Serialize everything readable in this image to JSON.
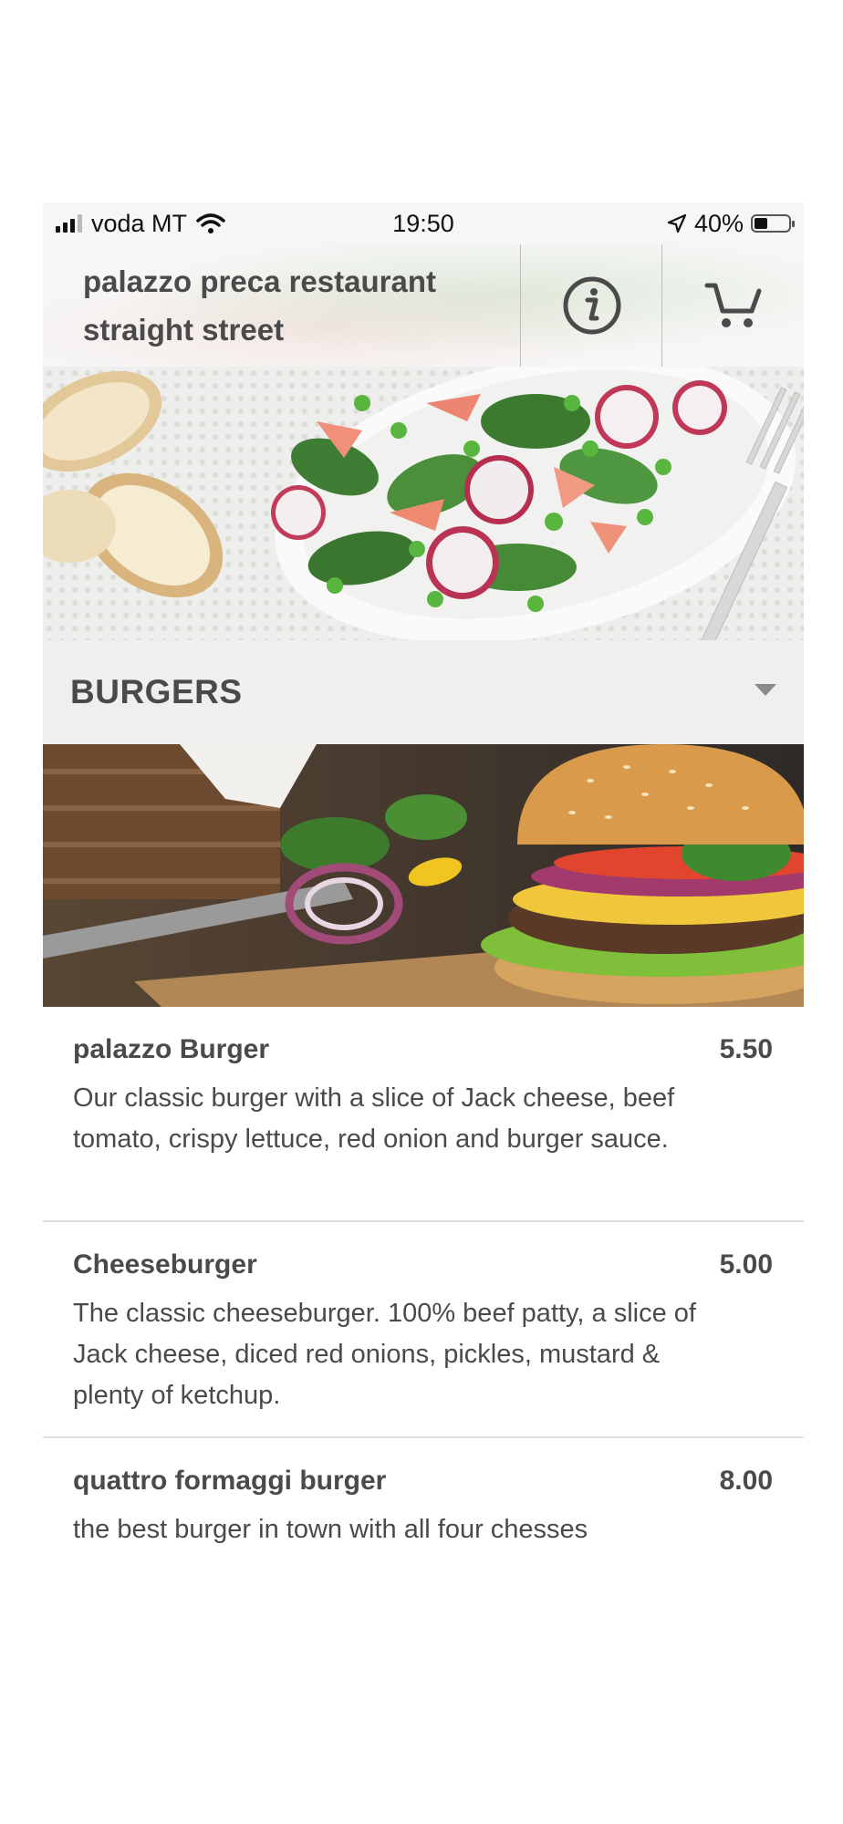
{
  "status_bar": {
    "carrier": "voda MT",
    "time": "19:50",
    "battery": "40%",
    "battery_level": 0.4
  },
  "header": {
    "restaurant_name": "palazzo preca restaurant straight street",
    "icons": [
      "info-icon",
      "cart-icon"
    ]
  },
  "category": {
    "title": "BURGERS",
    "expanded": true
  },
  "menu_items": [
    {
      "name": "palazzo Burger",
      "price": "5.50",
      "description": "Our classic burger with a slice of Jack cheese, beef tomato, crispy lettuce, red onion and burger sauce."
    },
    {
      "name": "Cheeseburger",
      "price": "5.00",
      "description": "The classic cheeseburger. 100% beef patty, a slice of Jack cheese, diced red onions, pickles, mustard & plenty of ketchup."
    },
    {
      "name": "quattro formaggi burger",
      "price": "8.00",
      "description": "the best burger in town with all four chesses"
    }
  ],
  "colors": {
    "text": "#4a4a4a",
    "category_bar": "#efefef",
    "divider": "#dedede"
  }
}
